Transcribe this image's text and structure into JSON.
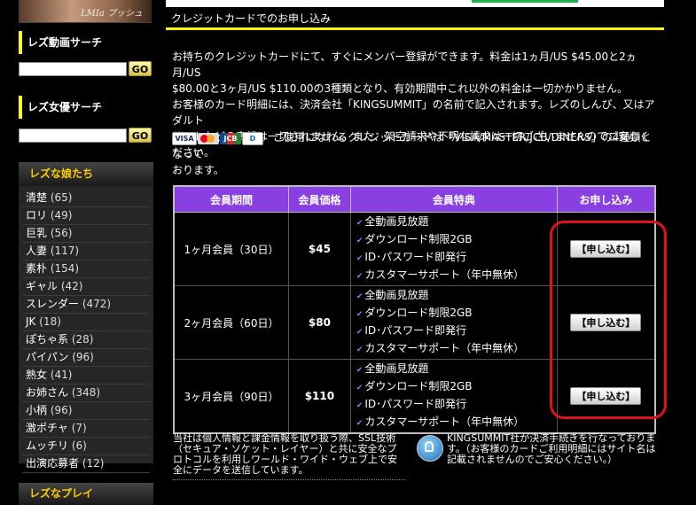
{
  "sidebar": {
    "banner_text": "LMIa プッシュ",
    "search_video": {
      "title": "レズ動画サーチ",
      "go": "GO"
    },
    "search_actress": {
      "title": "レズ女優サーチ",
      "go": "GO"
    },
    "categories_title": "レズな娘たち",
    "categories": [
      {
        "name": "清楚",
        "count": "(65)"
      },
      {
        "name": "ロリ",
        "count": "(49)"
      },
      {
        "name": "巨乳",
        "count": "(56)"
      },
      {
        "name": "人妻",
        "count": "(117)"
      },
      {
        "name": "素朴",
        "count": "(154)"
      },
      {
        "name": "ギャル",
        "count": "(42)"
      },
      {
        "name": "スレンダー",
        "count": "(472)"
      },
      {
        "name": "JK",
        "count": "(18)"
      },
      {
        "name": "ぽちゃ系",
        "count": "(28)"
      },
      {
        "name": "パイパン",
        "count": "(96)"
      },
      {
        "name": "熟女",
        "count": "(41)"
      },
      {
        "name": "お姉さん",
        "count": "(348)"
      },
      {
        "name": "小柄",
        "count": "(96)"
      },
      {
        "name": "激ポチャ",
        "count": "(7)"
      },
      {
        "name": "ムッチリ",
        "count": "(6)"
      },
      {
        "name": "出演応募者",
        "count": "(12)"
      }
    ],
    "next_section_title": "レズなプレイ"
  },
  "main": {
    "section_title": "クレジットカードでのお申し込み",
    "intro_line1": "お持ちのクレジットカードにて、すぐにメンバー登録ができます。料金は1ヵ月/US $45.00と2ヵ月/US",
    "intro_line2": "$80.00と3ヶ月/US $110.00の3種類となり、有効期間中これ以外の料金は一切かかりません。",
    "intro_line3": "お客様のカード明細には、決済会社「KINGSUMMIT」の名前で記入されます。レズのしんぴ、又はアダルト",
    "intro_line4": "サイトなどの表記は一切されません。また、架空請求や不明な請求は一切ございませんのでご安心ください。",
    "cards_logos": [
      "VISA",
      "",
      "JCB",
      "D"
    ],
    "cards_text": "ご使用になれるクレジットカードは「VISA/MASTER/JCB/DINERS」の4種類となって",
    "cards_text2": "おります。",
    "table": {
      "headers": [
        "会員期間",
        "会員価格",
        "会員特典",
        "お申し込み"
      ],
      "benefits": [
        "全動画見放題",
        "ダウンロード制限2GB",
        "ID･パスワード即発行",
        "カスタマーサポート（年中無休）"
      ],
      "rows": [
        {
          "period": "1ヶ月会員（30日）",
          "price": "$45",
          "button": "【申し込む】"
        },
        {
          "period": "2ヶ月会員（60日）",
          "price": "$80",
          "button": "【申し込む】"
        },
        {
          "period": "3ヶ月会員（90日）",
          "price": "$110",
          "button": "【申し込む】"
        }
      ]
    },
    "footer_left": "当社は個人情報と課金情報を取り扱う際、SSL技術（セキュア・ソケット・レイヤー）と共に安全なプロトコルを利用しワールド・ワイド・ウェブ上で安全にデータを送信しています。",
    "footer_right": "KINGSUMMIT社が決済手続きを行なっております。（お客様のカードご利用明細にはサイト名は記載されませんのでご安心ください。）"
  }
}
